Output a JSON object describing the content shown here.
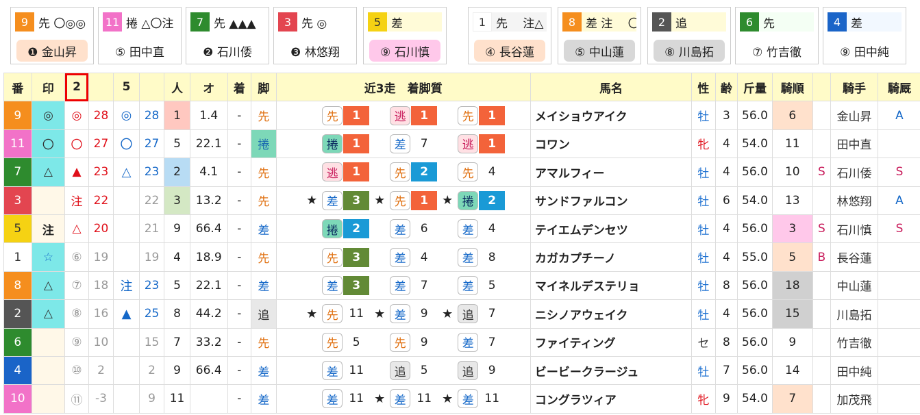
{
  "cards": [
    {
      "num": "9",
      "num_bg": "#f58e1e",
      "num_fg": "#ffffff",
      "sub": "先 〇◎◎",
      "sub_bg": "#ffffff",
      "name": "❶ 金山昇",
      "name_bg": "#ffe1cc"
    },
    {
      "num": "11",
      "num_bg": "#f272c8",
      "num_fg": "#ffffff",
      "sub": "捲 △〇注",
      "sub_bg": "#ffffff",
      "name": "⑤ 田中直",
      "name_bg": "#ffffff"
    },
    {
      "num": "7",
      "num_bg": "#2e8b2e",
      "num_fg": "#ffffff",
      "sub": "先 ▲▲▲",
      "sub_bg": "#ffffff",
      "name": "❷ 石川倭",
      "name_bg": "#ffffff"
    },
    {
      "num": "3",
      "num_bg": "#e34550",
      "num_fg": "#ffffff",
      "sub": "先 ◎",
      "sub_bg": "#ffffff",
      "name": "❸ 林悠翔",
      "name_bg": "#ffffff"
    },
    {
      "num": "5",
      "num_bg": "#f5d213",
      "num_fg": "#333333",
      "sub": "差",
      "sub_bg": "#fffbd8",
      "name": "⑨ 石川慎",
      "name_bg": "#ffc8ea"
    },
    {
      "num": "1",
      "num_bg": "#ffffff",
      "num_fg": "#333333",
      "sub": "先　 注△",
      "sub_bg": "#f4f4f4",
      "name": "④ 長谷蓮",
      "name_bg": "#ffe1cc"
    },
    {
      "num": "8",
      "num_bg": "#f58e1e",
      "num_fg": "#ffffff",
      "sub": "差 注　 〇",
      "sub_bg": "#fffbd8",
      "name": "⑤ 中山蓮",
      "name_bg": "#d8d8d8"
    },
    {
      "num": "2",
      "num_bg": "#555555",
      "num_fg": "#ffffff",
      "sub": "追",
      "sub_bg": "#fffbd8",
      "name": "⑧ 川島拓",
      "name_bg": "#d8d8d8"
    },
    {
      "num": "6",
      "num_bg": "#2e8b2e",
      "num_fg": "#ffffff",
      "sub": "先",
      "sub_bg": "#f4fff4",
      "name": "⑦ 竹吉徹",
      "name_bg": "#ffffff"
    },
    {
      "num": "4",
      "num_bg": "#1a64c8",
      "num_fg": "#ffffff",
      "sub": "差",
      "sub_bg": "#f2f8ff",
      "name": "⑨ 田中純",
      "name_bg": "#ffffff"
    }
  ],
  "headers": {
    "ban": "番",
    "shirushi": "印",
    "col2": "2",
    "col5": "5",
    "ninki": "人",
    "odds": "オ",
    "chaku": "着",
    "kyaku": "脚",
    "recent": "近3走　着脚質",
    "horse": "馬名",
    "sex": "性",
    "age": "齢",
    "weight": "斤量",
    "kijun": "騎順",
    "jockey": "騎手",
    "kibi": "騎厩"
  },
  "rows": [
    {
      "ban": "9",
      "ban_bg": "#f58e1e",
      "ban_fg": "#ffffff",
      "mark": "◎",
      "mark_bg": "#7de8e8",
      "c2m": "◎",
      "c2n": "28",
      "c5m": "◎",
      "c5n": "28",
      "ninki": "1",
      "ninki_bg": "#ffc8c0",
      "odds": "1.4",
      "chaku": "-",
      "kyaku": "先",
      "kyaku_cls": "sente",
      "kyaku_bg": "",
      "recent": [
        {
          "st": "",
          "t": "先",
          "tc": "s",
          "p": "1",
          "pc": "c1"
        },
        {
          "st": "",
          "t": "逃",
          "tc": "n",
          "p": "1",
          "pc": "c1"
        },
        {
          "st": "",
          "t": "先",
          "tc": "s",
          "p": "1",
          "pc": "c1"
        }
      ],
      "horse": "メイショウアイク",
      "sex": "牡",
      "sex_cls": "sex-m",
      "age": "3",
      "weight": "56.0",
      "kijun": "6",
      "kijun_bg": "#ffe1cc",
      "s": "",
      "jockey": "金山昇",
      "kibi": "A",
      "kibi_cls": "mk-blue"
    },
    {
      "ban": "11",
      "ban_bg": "#f272c8",
      "ban_fg": "#ffffff",
      "mark": "〇",
      "mark_bg": "#7de8e8",
      "c2m": "〇",
      "c2n": "27",
      "c5m": "〇",
      "c5n": "27",
      "ninki": "5",
      "ninki_bg": "",
      "odds": "22.1",
      "chaku": "-",
      "kyaku": "捲",
      "kyaku_cls": "kake",
      "kyaku_bg": "#7dd8b8",
      "recent": [
        {
          "st": "",
          "t": "捲",
          "tc": "k",
          "p": "1",
          "pc": "c1"
        },
        {
          "st": "",
          "t": "差",
          "tc": "a",
          "p": "7",
          "pc": ""
        },
        {
          "st": "",
          "t": "逃",
          "tc": "n",
          "p": "1",
          "pc": "c1"
        }
      ],
      "horse": "コワン",
      "sex": "牝",
      "sex_cls": "sex-f",
      "age": "4",
      "weight": "54.0",
      "kijun": "11",
      "kijun_bg": "",
      "s": "",
      "jockey": "田中直",
      "kibi": "",
      "kibi_cls": ""
    },
    {
      "ban": "7",
      "ban_bg": "#2e8b2e",
      "ban_fg": "#ffffff",
      "mark": "△",
      "mark_bg": "#7de8e8",
      "c2m": "▲",
      "c2n": "23",
      "c5m": "△",
      "c5n": "23",
      "ninki": "2",
      "ninki_bg": "#b8dcf4",
      "odds": "4.1",
      "chaku": "-",
      "kyaku": "先",
      "kyaku_cls": "sente",
      "kyaku_bg": "",
      "recent": [
        {
          "st": "",
          "t": "逃",
          "tc": "n",
          "p": "1",
          "pc": "c1"
        },
        {
          "st": "",
          "t": "先",
          "tc": "s",
          "p": "2",
          "pc": "c2"
        },
        {
          "st": "",
          "t": "先",
          "tc": "s",
          "p": "4",
          "pc": ""
        }
      ],
      "horse": "アマルフィー",
      "sex": "牡",
      "sex_cls": "sex-m",
      "age": "4",
      "weight": "56.0",
      "kijun": "10",
      "kijun_bg": "",
      "s": "S",
      "jockey": "石川倭",
      "kibi": "S",
      "kibi_cls": ""
    },
    {
      "ban": "3",
      "ban_bg": "#e34550",
      "ban_fg": "#ffffff",
      "mark": "",
      "mark_bg": "#fff8e8",
      "c2m": "注",
      "c2n": "22",
      "c5m": "",
      "c5n": "22",
      "ninki": "3",
      "ninki_bg": "#d4e8c4",
      "odds": "13.2",
      "chaku": "-",
      "kyaku": "先",
      "kyaku_cls": "sente",
      "kyaku_bg": "",
      "recent": [
        {
          "st": "★",
          "t": "差",
          "tc": "a",
          "p": "3",
          "pc": "c3"
        },
        {
          "st": "★",
          "t": "先",
          "tc": "s",
          "p": "1",
          "pc": "c1"
        },
        {
          "st": "★",
          "t": "捲",
          "tc": "k",
          "p": "2",
          "pc": "c2"
        }
      ],
      "horse": "サンドファルコン",
      "sex": "牡",
      "sex_cls": "sex-m",
      "age": "6",
      "weight": "54.0",
      "kijun": "13",
      "kijun_bg": "",
      "s": "",
      "jockey": "林悠翔",
      "kibi": "A",
      "kibi_cls": "mk-blue"
    },
    {
      "ban": "5",
      "ban_bg": "#f5d213",
      "ban_fg": "#333333",
      "mark": "注",
      "mark_bg": "#fff8e8",
      "c2m": "△",
      "c2n": "20",
      "c5m": "",
      "c5n": "21",
      "ninki": "9",
      "ninki_bg": "",
      "odds": "66.4",
      "chaku": "-",
      "kyaku": "差",
      "kyaku_cls": "sashi",
      "kyaku_bg": "",
      "recent": [
        {
          "st": "",
          "t": "捲",
          "tc": "k",
          "p": "2",
          "pc": "c2"
        },
        {
          "st": "",
          "t": "差",
          "tc": "a",
          "p": "6",
          "pc": ""
        },
        {
          "st": "",
          "t": "差",
          "tc": "a",
          "p": "4",
          "pc": ""
        }
      ],
      "horse": "テイエムデンセツ",
      "sex": "牡",
      "sex_cls": "sex-m",
      "age": "4",
      "weight": "56.0",
      "kijun": "3",
      "kijun_bg": "#ffc8ea",
      "s": "S",
      "jockey": "石川慎",
      "kibi": "S",
      "kibi_cls": ""
    },
    {
      "ban": "1",
      "ban_bg": "#ffffff",
      "ban_fg": "#333333",
      "mark": "☆",
      "mark_bg": "#7de8e8",
      "c2m": "⑥",
      "c2n": "19",
      "c5m": "",
      "c5n": "19",
      "ninki": "4",
      "ninki_bg": "",
      "odds": "18.9",
      "chaku": "-",
      "kyaku": "先",
      "kyaku_cls": "sente",
      "kyaku_bg": "",
      "recent": [
        {
          "st": "",
          "t": "先",
          "tc": "s",
          "p": "3",
          "pc": "c3"
        },
        {
          "st": "",
          "t": "差",
          "tc": "a",
          "p": "4",
          "pc": ""
        },
        {
          "st": "",
          "t": "差",
          "tc": "a",
          "p": "8",
          "pc": ""
        }
      ],
      "horse": "カガカプチーノ",
      "sex": "牡",
      "sex_cls": "sex-m",
      "age": "4",
      "weight": "55.0",
      "kijun": "5",
      "kijun_bg": "#ffe1cc",
      "s": "B",
      "jockey": "長谷蓮",
      "kibi": "",
      "kibi_cls": ""
    },
    {
      "ban": "8",
      "ban_bg": "#f58e1e",
      "ban_fg": "#ffffff",
      "mark": "△",
      "mark_bg": "#7de8e8",
      "c2m": "⑦",
      "c2n": "18",
      "c5m": "注",
      "c5n": "23",
      "ninki": "5",
      "ninki_bg": "",
      "odds": "22.1",
      "chaku": "-",
      "kyaku": "差",
      "kyaku_cls": "sashi",
      "kyaku_bg": "",
      "recent": [
        {
          "st": "",
          "t": "差",
          "tc": "a",
          "p": "3",
          "pc": "c3"
        },
        {
          "st": "",
          "t": "差",
          "tc": "a",
          "p": "7",
          "pc": ""
        },
        {
          "st": "",
          "t": "差",
          "tc": "a",
          "p": "5",
          "pc": ""
        }
      ],
      "horse": "マイネルデステリョ",
      "sex": "牡",
      "sex_cls": "sex-m",
      "age": "8",
      "weight": "56.0",
      "kijun": "18",
      "kijun_bg": "#d0d0d0",
      "s": "",
      "jockey": "中山蓮",
      "kibi": "",
      "kibi_cls": ""
    },
    {
      "ban": "2",
      "ban_bg": "#555555",
      "ban_fg": "#ffffff",
      "mark": "△",
      "mark_bg": "#7de8e8",
      "c2m": "⑧",
      "c2n": "16",
      "c5m": "▲",
      "c5n": "25",
      "ninki": "8",
      "ninki_bg": "",
      "odds": "44.2",
      "chaku": "-",
      "kyaku": "追",
      "kyaku_cls": "oi",
      "kyaku_bg": "#e8e8e8",
      "recent": [
        {
          "st": "★",
          "t": "先",
          "tc": "s",
          "p": "11",
          "pc": ""
        },
        {
          "st": "★",
          "t": "差",
          "tc": "a",
          "p": "9",
          "pc": ""
        },
        {
          "st": "★",
          "t": "追",
          "tc": "o",
          "p": "7",
          "pc": ""
        }
      ],
      "horse": "ニシノアウェイク",
      "sex": "牡",
      "sex_cls": "sex-m",
      "age": "4",
      "weight": "56.0",
      "kijun": "15",
      "kijun_bg": "#d0d0d0",
      "s": "",
      "jockey": "川島拓",
      "kibi": "",
      "kibi_cls": ""
    },
    {
      "ban": "6",
      "ban_bg": "#2e8b2e",
      "ban_fg": "#ffffff",
      "mark": "",
      "mark_bg": "#fff8e8",
      "c2m": "⑨",
      "c2n": "10",
      "c5m": "",
      "c5n": "15",
      "ninki": "7",
      "ninki_bg": "",
      "odds": "33.2",
      "chaku": "-",
      "kyaku": "先",
      "kyaku_cls": "sente",
      "kyaku_bg": "",
      "recent": [
        {
          "st": "",
          "t": "先",
          "tc": "s",
          "p": "5",
          "pc": ""
        },
        {
          "st": "",
          "t": "先",
          "tc": "s",
          "p": "9",
          "pc": ""
        },
        {
          "st": "",
          "t": "差",
          "tc": "a",
          "p": "7",
          "pc": ""
        }
      ],
      "horse": "ファイティング",
      "sex": "セ",
      "sex_cls": "sex-g",
      "age": "8",
      "weight": "56.0",
      "kijun": "9",
      "kijun_bg": "",
      "s": "",
      "jockey": "竹吉徹",
      "kibi": "",
      "kibi_cls": ""
    },
    {
      "ban": "4",
      "ban_bg": "#1a64c8",
      "ban_fg": "#ffffff",
      "mark": "",
      "mark_bg": "#fff8e8",
      "c2m": "⑩",
      "c2n": "2",
      "c5m": "",
      "c5n": "2",
      "ninki": "9",
      "ninki_bg": "",
      "odds": "66.4",
      "chaku": "-",
      "kyaku": "差",
      "kyaku_cls": "sashi",
      "kyaku_bg": "",
      "recent": [
        {
          "st": "",
          "t": "差",
          "tc": "a",
          "p": "11",
          "pc": ""
        },
        {
          "st": "",
          "t": "追",
          "tc": "o",
          "p": "5",
          "pc": ""
        },
        {
          "st": "",
          "t": "追",
          "tc": "o",
          "p": "9",
          "pc": ""
        }
      ],
      "horse": "ビービークラージュ",
      "sex": "牡",
      "sex_cls": "sex-m",
      "age": "7",
      "weight": "56.0",
      "kijun": "14",
      "kijun_bg": "",
      "s": "",
      "jockey": "田中純",
      "kibi": "",
      "kibi_cls": ""
    },
    {
      "ban": "10",
      "ban_bg": "#f272c8",
      "ban_fg": "#ffffff",
      "mark": "",
      "mark_bg": "#fff8e8",
      "c2m": "⑪",
      "c2n": "-3",
      "c5m": "",
      "c5n": "9",
      "ninki": "11",
      "ninki_bg": "",
      "odds": "",
      "chaku": "-",
      "kyaku": "差",
      "kyaku_cls": "sashi",
      "kyaku_bg": "",
      "recent": [
        {
          "st": "",
          "t": "差",
          "tc": "a",
          "p": "11",
          "pc": ""
        },
        {
          "st": "★",
          "t": "差",
          "tc": "a",
          "p": "11",
          "pc": ""
        },
        {
          "st": "★",
          "t": "差",
          "tc": "a",
          "p": "11",
          "pc": ""
        }
      ],
      "horse": "コングラツィア",
      "sex": "牝",
      "sex_cls": "sex-f",
      "age": "9",
      "weight": "54.0",
      "kijun": "7",
      "kijun_bg": "#ffe1cc",
      "s": "",
      "jockey": "加茂飛",
      "kibi": "",
      "kibi_cls": ""
    }
  ]
}
